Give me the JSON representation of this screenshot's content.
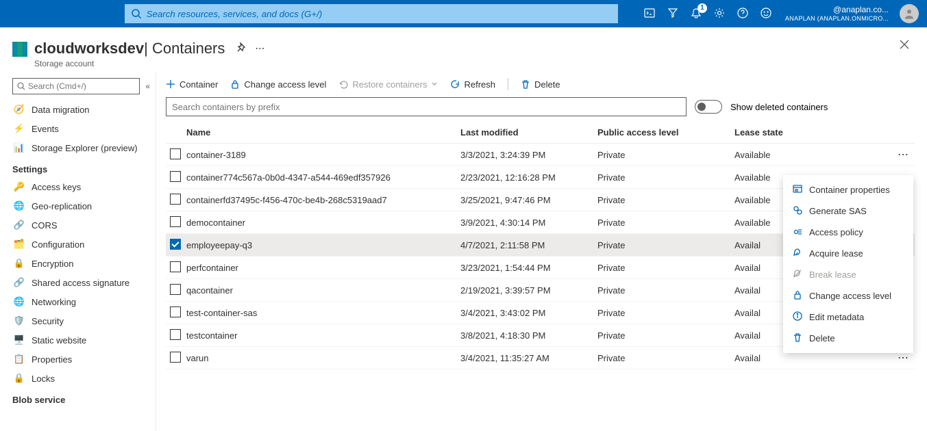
{
  "topbar": {
    "search_placeholder": "Search resources, services, and docs (G+/)",
    "notification_count": "1",
    "account_line1": "@anaplan.co...",
    "account_line2": "ANAPLAN (ANAPLAN.ONMICRO..."
  },
  "header": {
    "title_bold": "cloudworksdev",
    "title_rest": " | Containers",
    "subtitle": "Storage account"
  },
  "sidebar": {
    "search_placeholder": "Search (Cmd+/)",
    "items_top": [
      {
        "label": "Data migration",
        "icon": "🧭"
      },
      {
        "label": "Events",
        "icon": "⚡"
      },
      {
        "label": "Storage Explorer (preview)",
        "icon": "📊"
      }
    ],
    "heading1": "Settings",
    "items_settings": [
      {
        "label": "Access keys",
        "icon": "🔑"
      },
      {
        "label": "Geo-replication",
        "icon": "🌐"
      },
      {
        "label": "CORS",
        "icon": "🔗"
      },
      {
        "label": "Configuration",
        "icon": "🗂️"
      },
      {
        "label": "Encryption",
        "icon": "🔒"
      },
      {
        "label": "Shared access signature",
        "icon": "🔗"
      },
      {
        "label": "Networking",
        "icon": "🌐"
      },
      {
        "label": "Security",
        "icon": "🛡️"
      },
      {
        "label": "Static website",
        "icon": "🖥️"
      },
      {
        "label": "Properties",
        "icon": "📋"
      },
      {
        "label": "Locks",
        "icon": "🔒"
      }
    ],
    "heading2": "Blob service"
  },
  "toolbar": {
    "add_container": "Container",
    "change_access": "Change access level",
    "restore": "Restore containers",
    "refresh": "Refresh",
    "delete": "Delete"
  },
  "filter": {
    "prefix_placeholder": "Search containers by prefix",
    "toggle_label": "Show deleted containers"
  },
  "table": {
    "headers": {
      "name": "Name",
      "modified": "Last modified",
      "access": "Public access level",
      "lease": "Lease state"
    },
    "rows": [
      {
        "name": "container-3189",
        "modified": "3/3/2021, 3:24:39 PM",
        "access": "Private",
        "lease": "Available",
        "selected": false
      },
      {
        "name": "container774c567a-0b0d-4347-a544-469edf357926",
        "modified": "2/23/2021, 12:16:28 PM",
        "access": "Private",
        "lease": "Available",
        "selected": false
      },
      {
        "name": "containerfd37495c-f456-470c-be4b-268c5319aad7",
        "modified": "3/25/2021, 9:47:46 PM",
        "access": "Private",
        "lease": "Available",
        "selected": false
      },
      {
        "name": "democontainer",
        "modified": "3/9/2021, 4:30:14 PM",
        "access": "Private",
        "lease": "Available",
        "selected": false
      },
      {
        "name": "employeepay-q3",
        "modified": "4/7/2021, 2:11:58 PM",
        "access": "Private",
        "lease": "Availal",
        "selected": true
      },
      {
        "name": "perfcontainer",
        "modified": "3/23/2021, 1:54:44 PM",
        "access": "Private",
        "lease": "Availal",
        "selected": false
      },
      {
        "name": "qacontainer",
        "modified": "2/19/2021, 3:39:57 PM",
        "access": "Private",
        "lease": "Availal",
        "selected": false
      },
      {
        "name": "test-container-sas",
        "modified": "3/4/2021, 3:43:02 PM",
        "access": "Private",
        "lease": "Availal",
        "selected": false
      },
      {
        "name": "testcontainer",
        "modified": "3/8/2021, 4:18:30 PM",
        "access": "Private",
        "lease": "Availal",
        "selected": false
      },
      {
        "name": "varun",
        "modified": "3/4/2021, 11:35:27 AM",
        "access": "Private",
        "lease": "Availal",
        "selected": false
      }
    ]
  },
  "context_menu": {
    "items": [
      {
        "label": "Container properties",
        "icon": "props",
        "disabled": false
      },
      {
        "label": "Generate SAS",
        "icon": "sas",
        "disabled": false
      },
      {
        "label": "Access policy",
        "icon": "policy",
        "disabled": false
      },
      {
        "label": "Acquire lease",
        "icon": "acquire",
        "disabled": false
      },
      {
        "label": "Break lease",
        "icon": "breaklease",
        "disabled": true
      },
      {
        "label": "Change access level",
        "icon": "lock",
        "disabled": false
      },
      {
        "label": "Edit metadata",
        "icon": "info",
        "disabled": false
      },
      {
        "label": "Delete",
        "icon": "delete",
        "disabled": false
      }
    ]
  }
}
